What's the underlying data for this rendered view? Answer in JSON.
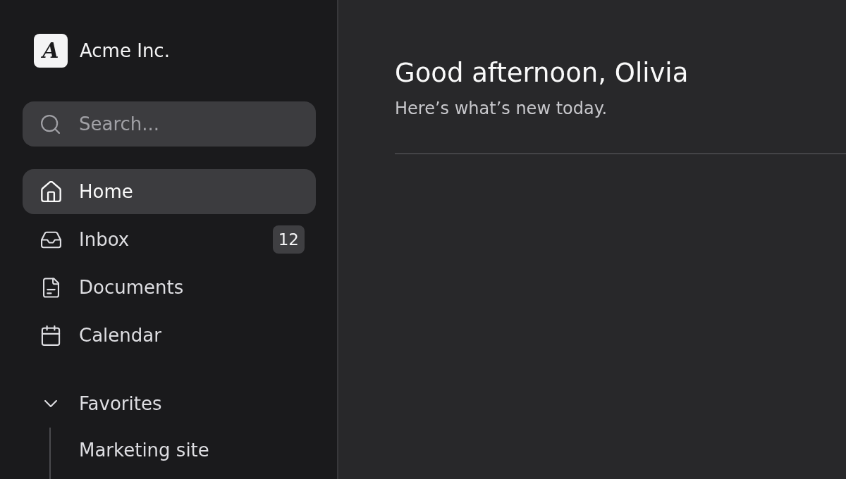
{
  "sidebar": {
    "logo": {
      "letter": "A",
      "name": "Acme Inc."
    },
    "search": {
      "placeholder": "Search..."
    },
    "nav_items": [
      {
        "label": "Home",
        "selected": true
      },
      {
        "label": "Inbox",
        "selected": false,
        "badge": "12"
      },
      {
        "label": "Documents",
        "selected": false
      },
      {
        "label": "Calendar",
        "selected": false
      }
    ],
    "sections": [
      {
        "title": "Favorites",
        "expanded": true,
        "children": [
          {
            "label": "Marketing site",
            "selected": false
          }
        ]
      }
    ]
  },
  "main": {
    "heading": "Good afternoon, Olivia",
    "subtitle": "Here’s what’s new today."
  }
}
